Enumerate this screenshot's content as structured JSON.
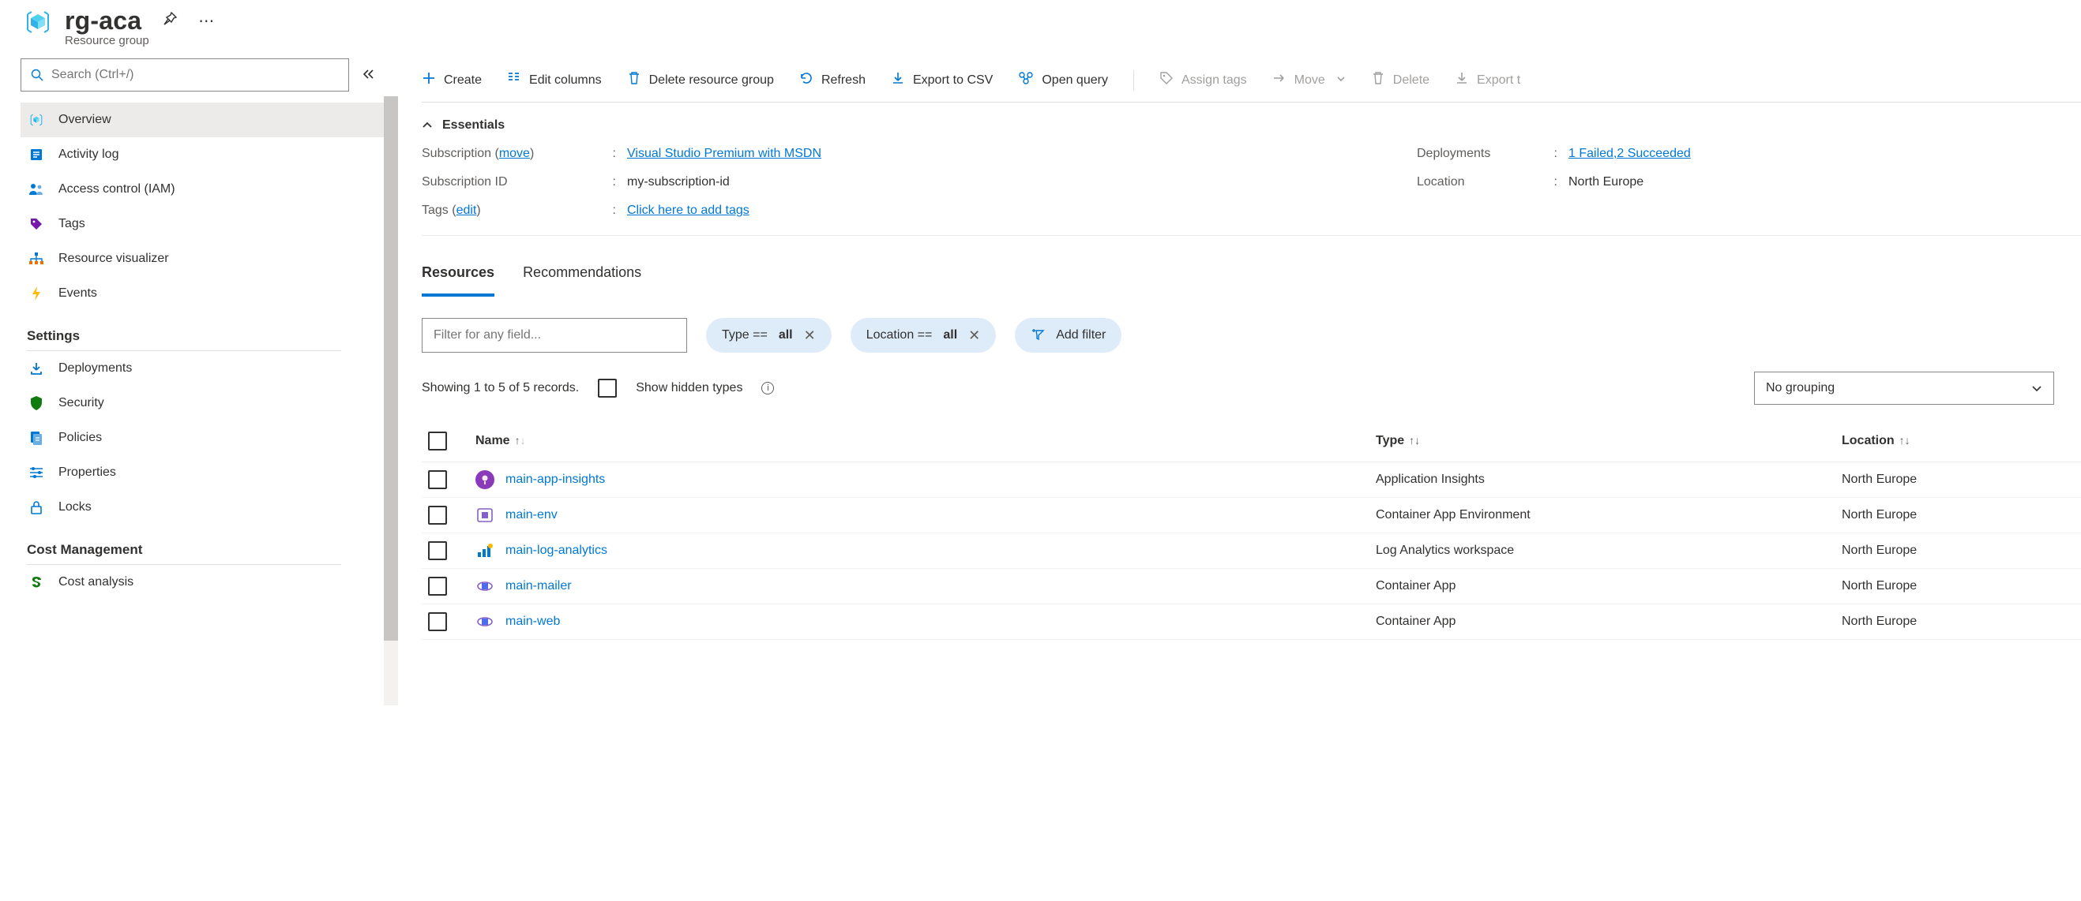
{
  "header": {
    "title": "rg-aca",
    "subtitle": "Resource group"
  },
  "sidebar": {
    "search_placeholder": "Search (Ctrl+/)",
    "sections": [
      {
        "label": null,
        "items": [
          {
            "id": "overview",
            "label": "Overview",
            "active": true
          },
          {
            "id": "activity-log",
            "label": "Activity log"
          },
          {
            "id": "access-control",
            "label": "Access control (IAM)"
          },
          {
            "id": "tags",
            "label": "Tags"
          },
          {
            "id": "resource-visualizer",
            "label": "Resource visualizer"
          },
          {
            "id": "events",
            "label": "Events"
          }
        ]
      },
      {
        "label": "Settings",
        "items": [
          {
            "id": "deployments",
            "label": "Deployments"
          },
          {
            "id": "security",
            "label": "Security"
          },
          {
            "id": "policies",
            "label": "Policies"
          },
          {
            "id": "properties",
            "label": "Properties"
          },
          {
            "id": "locks",
            "label": "Locks"
          }
        ]
      },
      {
        "label": "Cost Management",
        "items": [
          {
            "id": "cost-analysis",
            "label": "Cost analysis"
          }
        ]
      }
    ]
  },
  "toolbar": {
    "create": "Create",
    "edit_columns": "Edit columns",
    "delete_rg": "Delete resource group",
    "refresh": "Refresh",
    "export_csv": "Export to CSV",
    "open_query": "Open query",
    "assign_tags": "Assign tags",
    "move": "Move",
    "delete": "Delete",
    "export_template": "Export t"
  },
  "essentials": {
    "title": "Essentials",
    "subscription_key": "Subscription",
    "subscription_move": "move",
    "subscription_val": "Visual Studio Premium with MSDN",
    "subscription_id_key": "Subscription ID",
    "subscription_id_val": "my-subscription-id",
    "tags_key": "Tags",
    "tags_edit": "edit",
    "tags_val": "Click here to add tags",
    "deployments_key": "Deployments",
    "deployments_val": "1 Failed,2 Succeeded",
    "location_key": "Location",
    "location_val": "North Europe"
  },
  "tabs": {
    "resources": "Resources",
    "recommendations": "Recommendations"
  },
  "filters": {
    "placeholder": "Filter for any field...",
    "type_label": "Type ==",
    "type_value": "all",
    "location_label": "Location ==",
    "location_value": "all",
    "add_filter": "Add filter"
  },
  "records": {
    "summary": "Showing 1 to 5 of 5 records.",
    "show_hidden": "Show hidden types",
    "grouping": "No grouping"
  },
  "table": {
    "headers": {
      "name": "Name",
      "type": "Type",
      "location": "Location"
    },
    "rows": [
      {
        "name": "main-app-insights",
        "type": "Application Insights",
        "location": "North Europe",
        "icon": "insights"
      },
      {
        "name": "main-env",
        "type": "Container App Environment",
        "location": "North Europe",
        "icon": "env"
      },
      {
        "name": "main-log-analytics",
        "type": "Log Analytics workspace",
        "location": "North Europe",
        "icon": "log"
      },
      {
        "name": "main-mailer",
        "type": "Container App",
        "location": "North Europe",
        "icon": "app"
      },
      {
        "name": "main-web",
        "type": "Container App",
        "location": "North Europe",
        "icon": "app"
      }
    ]
  }
}
